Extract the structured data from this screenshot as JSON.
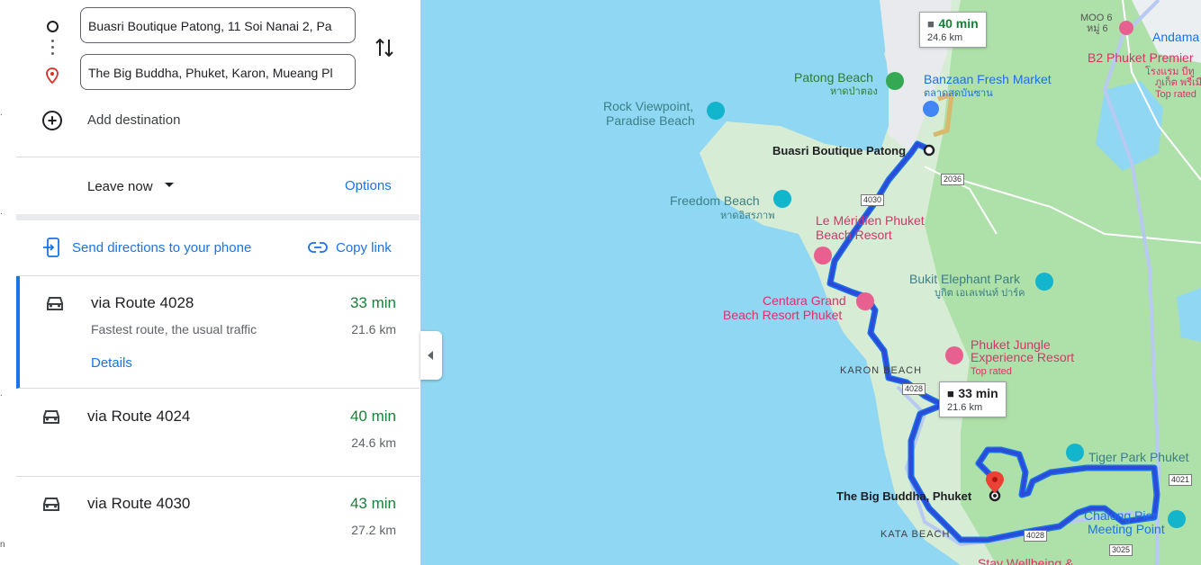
{
  "inputs": {
    "origin": "Buasri Boutique Patong, 11 Soi Nanai 2, Pa",
    "destination": "The Big Buddha, Phuket, Karon, Mueang Pl"
  },
  "add_destination": "Add destination",
  "leave_now": "Leave now",
  "options": "Options",
  "send_directions": "Send directions to your phone",
  "copy_link": "Copy link",
  "routes": [
    {
      "name": "via Route 4028",
      "duration": "33 min",
      "distance": "21.6 km",
      "description": "Fastest route, the usual traffic",
      "details": "Details"
    },
    {
      "name": "via Route 4024",
      "duration": "40 min",
      "distance": "24.6 km"
    },
    {
      "name": "via Route 4030",
      "duration": "43 min",
      "distance": "27.2 km"
    }
  ],
  "map": {
    "box_alt": {
      "duration": "40 min",
      "distance": "24.6 km"
    },
    "box_main": {
      "duration": "33 min",
      "distance": "21.6 km"
    },
    "labels": {
      "moo6": "MOO 6",
      "moo6_th": "หมู่ 6",
      "andaman": "Andama",
      "b2": "B2 Phuket Premier",
      "b2_th": "โรงแรม บีทู",
      "b2_th2": "ภูเก็ต พรีเมียร์",
      "top_rated1": "Top rated",
      "patong_beach": "Patong Beach",
      "patong_beach_th": "หาดป่าตอง",
      "banzaan": "Banzaan Fresh Market",
      "banzaan_th": "ตลาดสดบันซาน",
      "rock1": "Rock Viewpoint,",
      "rock2": "Paradise Beach",
      "buasri": "Buasri Boutique Patong",
      "freedom": "Freedom Beach",
      "freedom_th": "หาดอิสรภาพ",
      "lemeridien1": "Le Méridien Phuket",
      "lemeridien2": "Beach Resort",
      "bukit": "Bukit Elephant Park",
      "bukit_th": "บูกิต เอเลเฟนท์ ปาร์ค",
      "centara1": "Centara Grand",
      "centara2": "Beach Resort Phuket",
      "jungle1": "Phuket Jungle",
      "jungle2": "Experience Resort",
      "top_rated2": "Top rated",
      "karon": "KARON BEACH",
      "tiger": "Tiger Park Phuket",
      "bigbuddha": "The Big Buddha, Phuket",
      "chalong1": "Chalong Pier",
      "chalong2": "Meeting Point",
      "kata": "KATA BEACH",
      "stay": "Stay Wellbeing &"
    },
    "roads": {
      "r4030": "4030",
      "r2036": "2036",
      "r4028a": "4028",
      "r4028b": "4028",
      "r4021": "4021",
      "r3025": "3025"
    }
  }
}
